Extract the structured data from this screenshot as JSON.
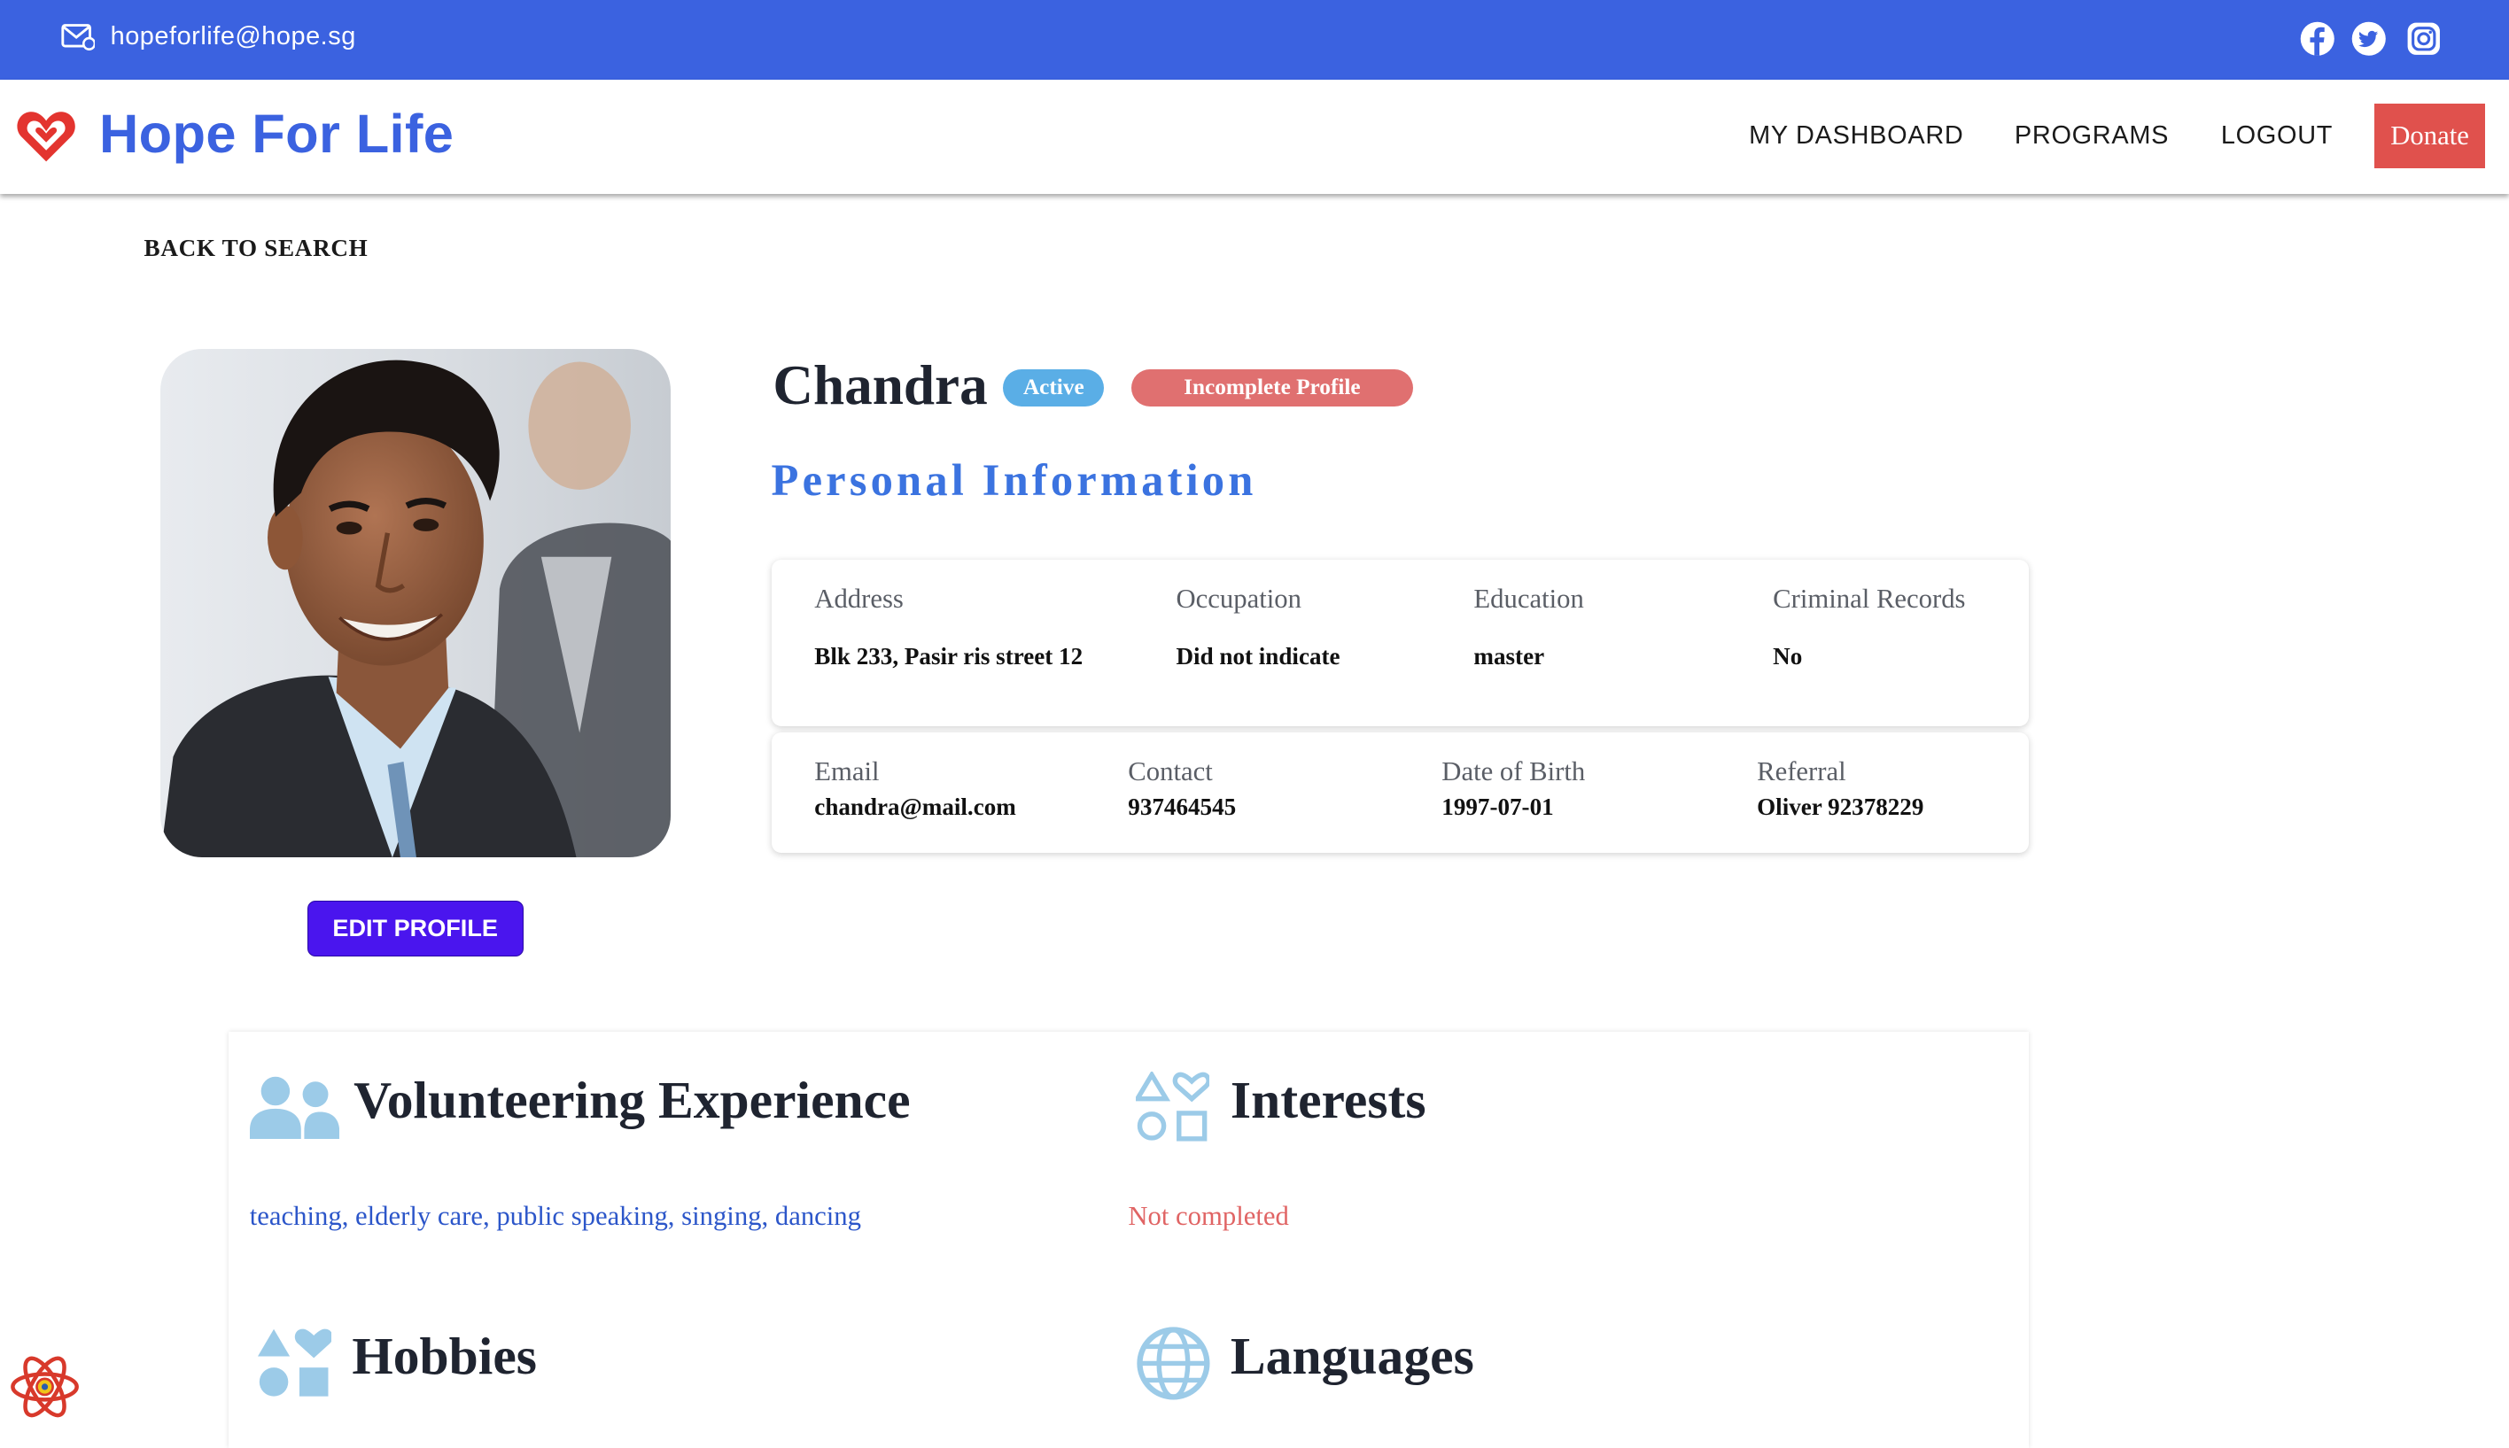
{
  "topbar": {
    "email": "hopeforlife@hope.sg",
    "icons": [
      "mail-icon",
      "facebook-icon",
      "twitter-icon",
      "instagram-icon"
    ],
    "color": "#3b62e0"
  },
  "navbar": {
    "brand": "Hope For Life",
    "links": {
      "dashboard": "MY DASHBOARD",
      "programs": "PROGRAMS",
      "logout": "LOGOUT"
    },
    "donate": "Donate",
    "donate_color": "#e0514d"
  },
  "back_link": "BACK TO SEARCH",
  "profile": {
    "name": "Chandra",
    "status_badge": "Active",
    "profile_badge": "Incomplete Profile",
    "edit_button": "EDIT PROFILE"
  },
  "personal_info": {
    "title": "Personal Information",
    "address": {
      "label": "Address",
      "value": "Blk 233, Pasir ris street 12"
    },
    "occupation": {
      "label": "Occupation",
      "value": "Did not indicate"
    },
    "education": {
      "label": "Education",
      "value": "master"
    },
    "criminal": {
      "label": "Criminal Records",
      "value": "No"
    },
    "email": {
      "label": "Email",
      "value": "chandra@mail.com"
    },
    "contact": {
      "label": "Contact",
      "value": "937464545"
    },
    "dob": {
      "label": "Date of Birth",
      "value": "1997-07-01"
    },
    "referral": {
      "label": "Referral",
      "value": "Oliver 92378229"
    }
  },
  "sections": {
    "volunteering": {
      "title": "Volunteering Experience",
      "items": [
        "teaching",
        "elderly care",
        "public speaking",
        "singing",
        "dancing"
      ],
      "items_text": "teaching, elderly care, public speaking, singing, dancing"
    },
    "interests": {
      "title": "Interests",
      "status": "Not completed"
    },
    "hobbies": {
      "title": "Hobbies"
    },
    "languages": {
      "title": "Languages"
    }
  }
}
